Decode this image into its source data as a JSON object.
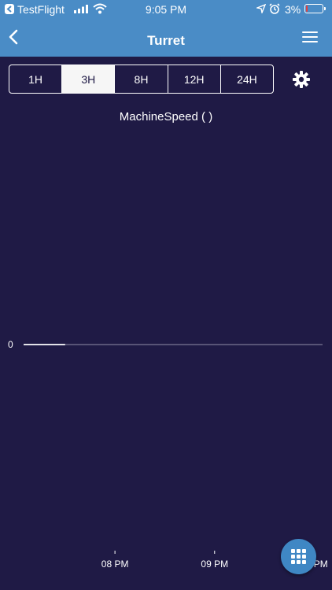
{
  "status_bar": {
    "app_name": "TestFlight",
    "time": "9:05 PM",
    "battery": "3%"
  },
  "header": {
    "title": "Turret"
  },
  "time_ranges": {
    "options": [
      "1H",
      "3H",
      "8H",
      "12H",
      "24H"
    ],
    "selected": "3H"
  },
  "chart_data": {
    "type": "line",
    "title": "MachineSpeed ( )",
    "xlabel": "",
    "ylabel": "",
    "y_ticks": [
      "0"
    ],
    "x_ticks": [
      "08 PM",
      "09 PM",
      "10 PM"
    ],
    "series": [
      {
        "x": [
          "07:05 PM",
          "07:30 PM"
        ],
        "values": [
          0,
          0
        ]
      }
    ],
    "xlim": [
      "07:05 PM",
      "10:05 PM"
    ],
    "grid": false,
    "legend": "none"
  },
  "colors": {
    "header_bg": "#4a8cc6",
    "page_bg": "#1f1a45",
    "fab_bg": "#3f87c4",
    "accent_text": "#ffffff"
  },
  "icons": {
    "back": "chevron-left-icon",
    "menu": "hamburger-menu-icon",
    "settings": "gear-icon",
    "fab": "grid-apps-icon"
  }
}
